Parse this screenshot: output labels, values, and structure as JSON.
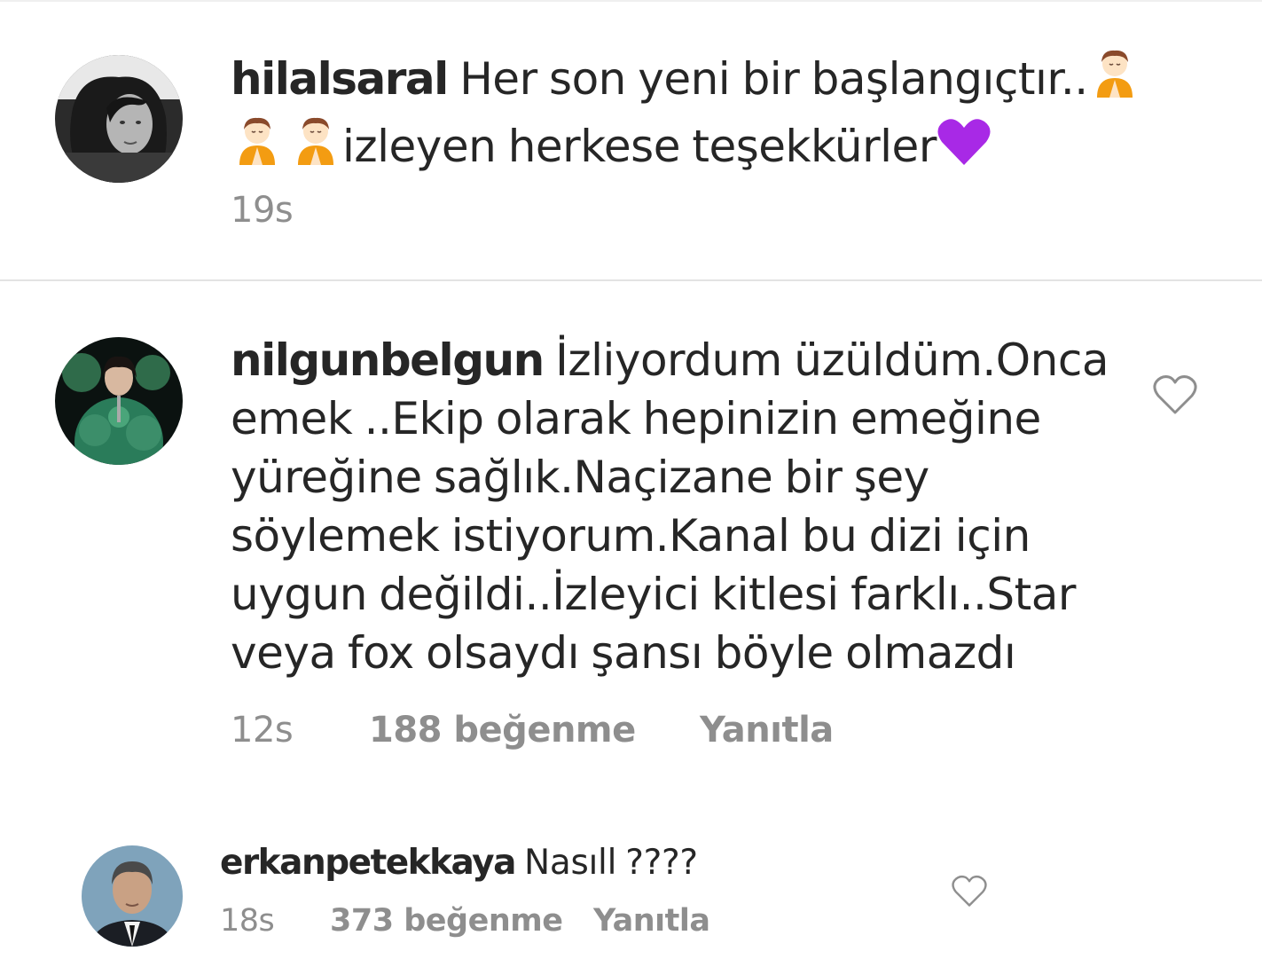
{
  "comments": [
    {
      "username": "hilalsaral",
      "text_part1": "Her son yeni bir başlangıçtır..",
      "text_part2": "izleyen herkese teşekkürler",
      "time": "19s",
      "emojis": [
        "person-folding-hands-emoji",
        "person-folding-hands-emoji",
        "person-folding-hands-emoji",
        "purple-heart-emoji"
      ]
    },
    {
      "username": "nilgunbelgun",
      "lines": [
        "İzliyordum üzüldüm.Onca",
        "emek ..Ekip olarak hepinizin emeğine",
        "yüreğine sağlık.Naçizane bir şey",
        "söylemek istiyorum.Kanal bu dizi için",
        "uygun değildi..İzleyici kitlesi farklı..Star",
        "veya fox olsaydı şansı böyle olmazdı"
      ],
      "time": "12s",
      "likes": "188 beğenme",
      "reply_label": "Yanıtla"
    },
    {
      "username": "erkanpetekkaya",
      "text": "Nasıll ????",
      "time": "18s",
      "likes": "373 beğenme",
      "reply_label": "Yanıtla"
    }
  ],
  "colors": {
    "text": "#262626",
    "meta": "#8e8e8e",
    "divider": "#e3e3e3",
    "emoji_orange": "#f39c12",
    "emoji_heart": "#a829e6"
  },
  "icons": {
    "like": "heart-outline-icon"
  }
}
